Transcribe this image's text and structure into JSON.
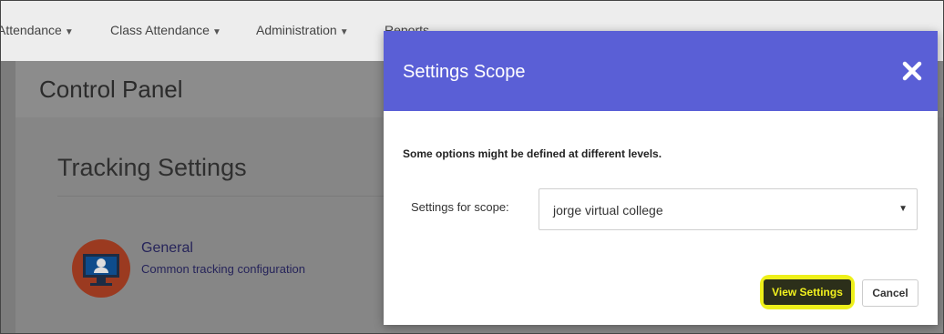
{
  "nav": {
    "items": [
      {
        "label": "Attendance"
      },
      {
        "label": "Class Attendance"
      },
      {
        "label": "Administration"
      },
      {
        "label": "Reports"
      }
    ]
  },
  "page": {
    "title": "Control Panel",
    "section_title": "Tracking Settings",
    "general": {
      "title": "General",
      "description": "Common tracking configuration"
    }
  },
  "modal": {
    "title": "Settings Scope",
    "notice": "Some options might be defined at different levels.",
    "scope_label": "Settings for scope:",
    "scope_value": "jorge virtual college",
    "view_button": "View Settings",
    "cancel_button": "Cancel"
  },
  "colors": {
    "modal_header": "#5a5fd6",
    "highlight": "#eef01a",
    "link": "#26245a"
  },
  "icons": [
    "caret-down-icon",
    "close-icon",
    "monitor-user-icon"
  ]
}
